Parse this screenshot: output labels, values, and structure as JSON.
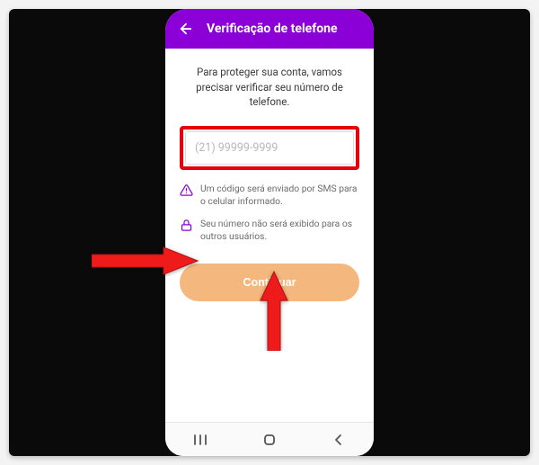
{
  "colors": {
    "accent": "#8b00d6",
    "cta": "#f4b87e",
    "highlight": "#e4000f"
  },
  "header": {
    "back_icon": "arrow-left",
    "title": "Verificação de telefone"
  },
  "instruction": "Para proteger sua conta, vamos precisar verificar seu número de telefone.",
  "phone_input": {
    "value": "",
    "placeholder": "(21) 99999-9999"
  },
  "info": [
    {
      "icon": "alert-triangle",
      "text": "Um código será enviado por SMS para o celular informado."
    },
    {
      "icon": "lock",
      "text": "Seu número não será exibido para os outros usuários."
    }
  ],
  "cta_label": "Continuar",
  "navbar": {
    "recents_icon": "recents",
    "home_icon": "home",
    "back_icon": "back"
  }
}
